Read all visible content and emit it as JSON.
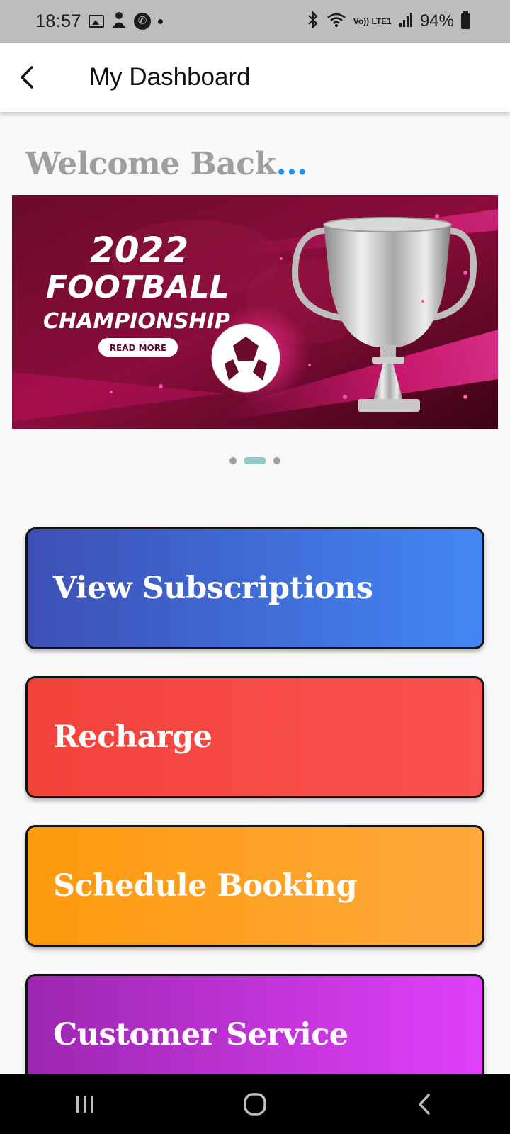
{
  "status_bar": {
    "time": "18:57",
    "battery": "94%",
    "network": "Vo)) LTE1",
    "icons": [
      "image-icon",
      "user-icon",
      "phone-icon",
      "dot-icon",
      "bluetooth-icon",
      "wifi-icon",
      "signal-icon",
      "battery-icon"
    ]
  },
  "app_bar": {
    "title": "My Dashboard",
    "back_icon": "back-arrow-icon"
  },
  "welcome": {
    "text": "Welcome Back",
    "dots": "..."
  },
  "banner": {
    "year": "2022",
    "line1": "FOOTBALL",
    "line2": "CHAMPIONSHIP",
    "button": "READ MORE"
  },
  "carousel": {
    "count": 3,
    "active_index": 1
  },
  "actions": [
    {
      "label": "View Subscriptions",
      "color_start": "#3d50b5",
      "color_end": "#4287f5"
    },
    {
      "label": "Recharge",
      "color_start": "#f2433a",
      "color_end": "#fb5150"
    },
    {
      "label": "Schedule Booking",
      "color_start": "#fe9a0c",
      "color_end": "#fea93d"
    },
    {
      "label": "Customer Service",
      "color_start": "#9c27b0",
      "color_end": "#e040fb"
    }
  ],
  "nav_bar": {
    "icons": [
      "recent-apps-icon",
      "home-icon",
      "back-icon"
    ]
  }
}
